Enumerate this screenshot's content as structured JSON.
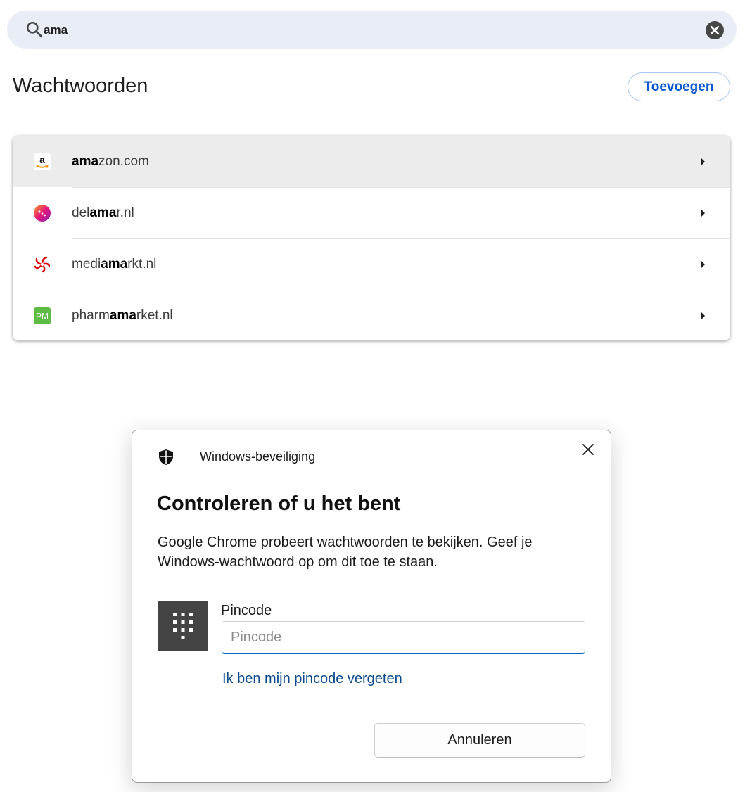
{
  "search": {
    "value": "ama",
    "search_icon": "search-icon",
    "clear_icon": "clear-icon"
  },
  "passwords": {
    "title": "Wachtwoorden",
    "add_label": "Toevoegen",
    "items": [
      {
        "pre": "",
        "match": "ama",
        "post": "zon.com",
        "icon": "amazon-favicon",
        "icon_text": "a",
        "hovered": true
      },
      {
        "pre": "del",
        "match": "ama",
        "post": "r.nl",
        "icon": "delamar-favicon",
        "icon_text": "",
        "hovered": false
      },
      {
        "pre": "medi",
        "match": "ama",
        "post": "rkt.nl",
        "icon": "mediamarkt-favicon",
        "icon_text": "",
        "hovered": false
      },
      {
        "pre": "pharm",
        "match": "ama",
        "post": "rket.nl",
        "icon": "pharmamarket-favicon",
        "icon_text": "PM",
        "hovered": false
      }
    ]
  },
  "dialog": {
    "app_name": "Windows-beveiliging",
    "heading": "Controleren of u het bent",
    "message": "Google Chrome probeert wachtwoorden te bekijken. Geef je Windows-wachtwoord op om dit toe te staan.",
    "pin_label": "Pincode",
    "pin_placeholder": "Pincode",
    "forgot_link": "Ik ben mijn pincode vergeten",
    "cancel_label": "Annuleren"
  },
  "colors": {
    "accent": "#0b57d0",
    "search_bg": "#e9eef6",
    "hover_row": "#ececec",
    "pm_green": "#5dbb46",
    "mediamarkt_red": "#df0000",
    "windows_blue": "#0067c0"
  }
}
